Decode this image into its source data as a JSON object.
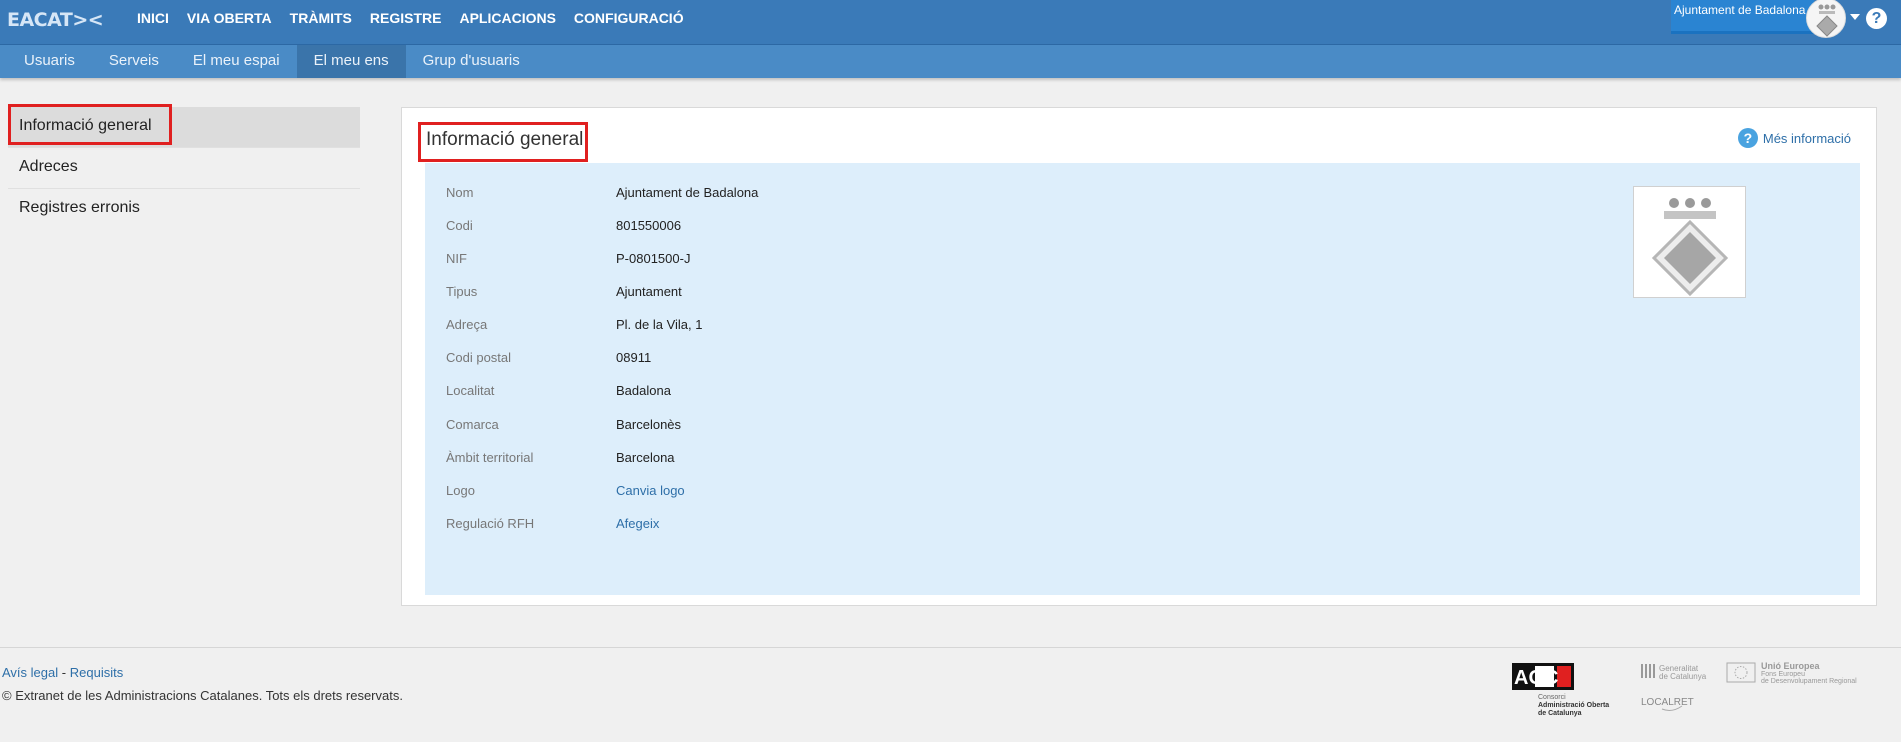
{
  "brand": "EACAT><",
  "top_nav": [
    "INICI",
    "VIA OBERTA",
    "TRÀMITS",
    "REGISTRE",
    "APLICACIONS",
    "CONFIGURACIÓ"
  ],
  "user": {
    "org_name": "Ajuntament de Badalona",
    "help": "?"
  },
  "sub_nav": [
    {
      "label": "Usuaris",
      "active": false
    },
    {
      "label": "Serveis",
      "active": false
    },
    {
      "label": "El meu espai",
      "active": false
    },
    {
      "label": "El meu ens",
      "active": true
    },
    {
      "label": "Grup d'usuaris",
      "active": false
    }
  ],
  "left_menu": [
    "Informació general",
    "Adreces",
    "Registres erronis"
  ],
  "panel": {
    "title": "Informació general",
    "more_info": "Més informació",
    "fields": [
      {
        "label": "Nom",
        "value": "Ajuntament de Badalona",
        "link": false
      },
      {
        "label": "Codi",
        "value": "801550006",
        "link": false
      },
      {
        "label": "NIF",
        "value": "P-0801500-J",
        "link": false
      },
      {
        "label": "Tipus",
        "value": "Ajuntament",
        "link": false
      },
      {
        "label": "Adreça",
        "value": "Pl. de la Vila, 1",
        "link": false
      },
      {
        "label": "Codi postal",
        "value": "08911",
        "link": false
      },
      {
        "label": "Localitat",
        "value": "Badalona",
        "link": false
      },
      {
        "label": "Comarca",
        "value": "Barcelonès",
        "link": false
      },
      {
        "label": "Àmbit territorial",
        "value": "Barcelona",
        "link": false
      },
      {
        "label": "Logo",
        "value": "Canvia logo",
        "link": true
      },
      {
        "label": "Regulació RFH",
        "value": "Afegeix",
        "link": true
      }
    ]
  },
  "footer": {
    "legal": "Avís legal",
    "separator": "-",
    "requirements": "Requisits",
    "copyright": "© Extranet de les Administracions Catalanes. Tots els drets reservats.",
    "logos": {
      "aoc": "AOC",
      "aoc_caption": [
        "Consorci",
        "Administració Oberta",
        "de Catalunya"
      ],
      "generalitat": [
        "Generalitat",
        "de Catalunya"
      ],
      "eu": [
        "Unió Europea",
        "Fons Europeu",
        "de Desenvolupament Regional"
      ],
      "localret": "LOCALRET"
    }
  },
  "colors": {
    "topbar": "#3a7ab8",
    "subbar": "#4a8bc6",
    "highlight": "#e02020",
    "info_bg": "#ddeefb",
    "link": "#2e6fa8"
  }
}
